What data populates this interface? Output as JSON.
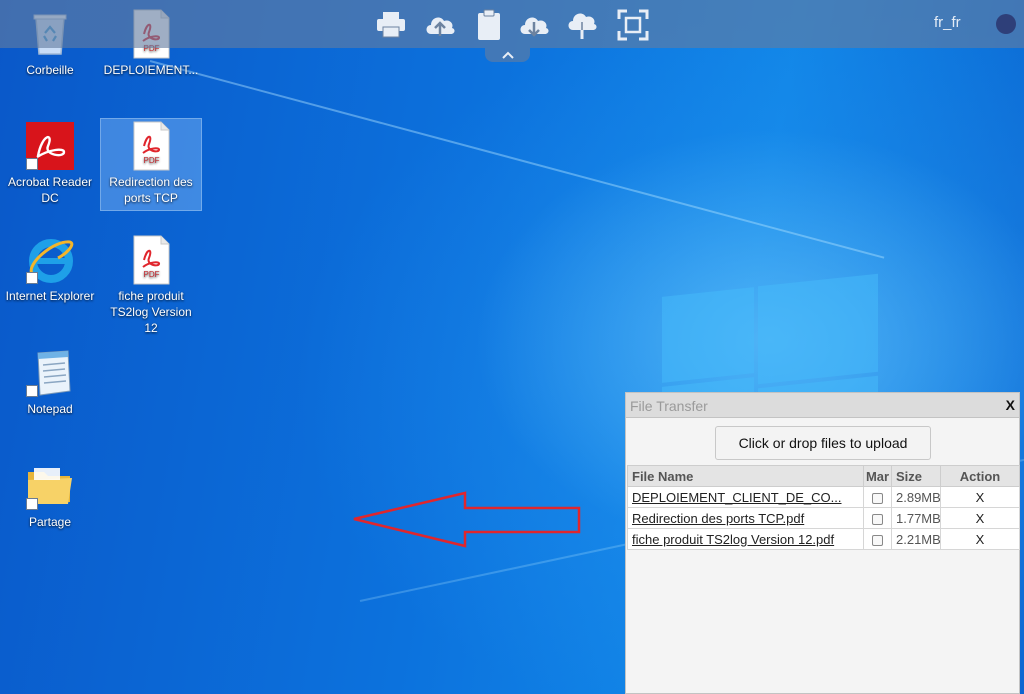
{
  "topbar": {
    "icons": [
      "printer-icon",
      "cloud-upload-icon",
      "clipboard-icon",
      "cloud-download-icon",
      "cloud-upload-alt-icon",
      "fullscreen-icon"
    ],
    "locale": "fr_fr"
  },
  "desktop": {
    "icons": [
      {
        "label": "Corbeille",
        "icon": "recycle-bin-icon"
      },
      {
        "label": "DEPLOIEMENT...",
        "icon": "pdf-file-icon"
      },
      {
        "label": "Acrobat Reader DC",
        "icon": "acrobat-reader-icon"
      },
      {
        "label": "Redirection des ports TCP",
        "icon": "pdf-file-icon"
      },
      {
        "label": "Internet Explorer",
        "icon": "internet-explorer-icon"
      },
      {
        "label": "fiche produit TS2log Version 12",
        "icon": "pdf-file-icon"
      },
      {
        "label": "Notepad",
        "icon": "notepad-icon"
      },
      {
        "label": "Partage",
        "icon": "folder-icon"
      }
    ],
    "pdf_badge": "PDF"
  },
  "file_transfer": {
    "title": "File Transfer",
    "close_label": "X",
    "upload_label": "Click or drop files to upload",
    "columns": [
      "File Name",
      "Mar",
      "Size",
      "Action"
    ],
    "rows": [
      {
        "name": "DEPLOIEMENT_CLIENT_DE_CO...",
        "size": "2.89MB",
        "action": "X"
      },
      {
        "name": "Redirection des ports TCP.pdf",
        "size": "1.77MB",
        "action": "X"
      },
      {
        "name": "fiche produit TS2log Version 12.pdf",
        "size": "2.21MB",
        "action": "X"
      }
    ]
  },
  "colors": {
    "arrow": "#e0262d",
    "desktop_blue": "#0c72dd"
  }
}
